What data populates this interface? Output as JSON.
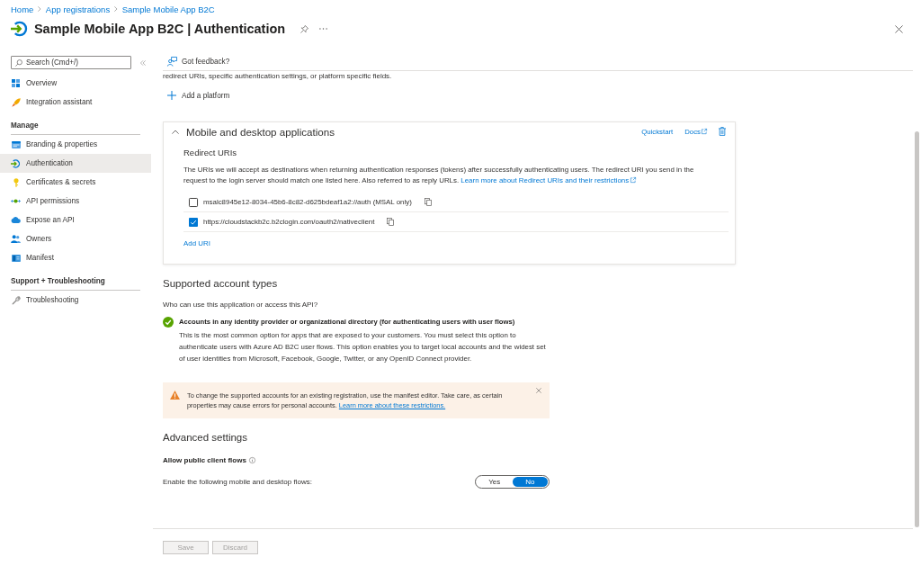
{
  "breadcrumb": [
    {
      "label": "Home"
    },
    {
      "label": "App registrations"
    },
    {
      "label": "Sample Mobile App B2C"
    }
  ],
  "header": {
    "title": "Sample Mobile App B2C | Authentication"
  },
  "sidebar": {
    "search": {
      "placeholder": "Search (Cmd+/)"
    },
    "groups": [
      {
        "items": [
          {
            "label": "Overview",
            "selected": false
          },
          {
            "label": "Integration assistant",
            "selected": false
          }
        ]
      },
      {
        "heading": "Manage",
        "items": [
          {
            "label": "Branding & properties",
            "selected": false
          },
          {
            "label": "Authentication",
            "selected": true
          },
          {
            "label": "Certificates & secrets",
            "selected": false
          },
          {
            "label": "API permissions",
            "selected": false
          },
          {
            "label": "Expose an API",
            "selected": false
          },
          {
            "label": "Owners",
            "selected": false
          },
          {
            "label": "Manifest",
            "selected": false
          }
        ]
      },
      {
        "heading": "Support + Troubleshooting",
        "items": [
          {
            "label": "Troubleshooting",
            "selected": false
          }
        ]
      }
    ]
  },
  "toolbar": {
    "feedback": "Got feedback?"
  },
  "platforms": {
    "intro": "redirect URIs, specific authentication settings, or platform specific fields.",
    "add_platform": "Add a platform",
    "card": {
      "title": "Mobile and desktop applications",
      "expanded": true,
      "quickstart": "Quickstart",
      "docs": "Docs",
      "redirect_uris": {
        "heading": "Redirect URIs",
        "description": "The URIs we will accept as destinations when returning authentication responses (tokens) after successfully authenticating users. The redirect URI you send in the request to the login server should match one listed here. Also referred to as reply URLs.",
        "learn_more": "Learn more about Redirect URIs and their restrictions",
        "uris": [
          {
            "value": "msalc8945e12-8034-45b6-8c82-d625bdeaf1a2://auth (MSAL only)",
            "checked": false
          },
          {
            "value": "https://cloudstackb2c.b2clogin.com/oauth2/nativeclient",
            "checked": true
          }
        ],
        "add_uri": "Add URI"
      }
    }
  },
  "account_types": {
    "heading": "Supported account types",
    "question": "Who can use this application or access this API?",
    "options": [
      {
        "label": "Accounts in any identity provider or organizational directory (for authenticating users with user flows)",
        "description": "This is the most common option for apps that are exposed to your customers. You must select this option to authenticate users with Azure AD B2C user flows. This option enables you to target local accounts and the widest set of user identities from Microsoft, Facebook, Google, Twitter, or any OpenID Connect provider.",
        "selected": true
      }
    ]
  },
  "warning": {
    "text": "To change the supported accounts for an existing registration, use the manifest editor. Take care, as certain properties may cause errors for personal accounts.",
    "link": "Learn more about these restrictions."
  },
  "advanced": {
    "heading": "Advanced settings",
    "public_client": {
      "label": "Allow public client flows",
      "description": "Enable the following mobile and desktop flows:",
      "options": [
        {
          "label": "Yes",
          "selected": false
        },
        {
          "label": "No",
          "selected": true
        }
      ]
    }
  },
  "footer": {
    "buttons": [
      {
        "label": "Save",
        "disabled": true
      },
      {
        "label": "Discard",
        "disabled": true
      }
    ]
  }
}
